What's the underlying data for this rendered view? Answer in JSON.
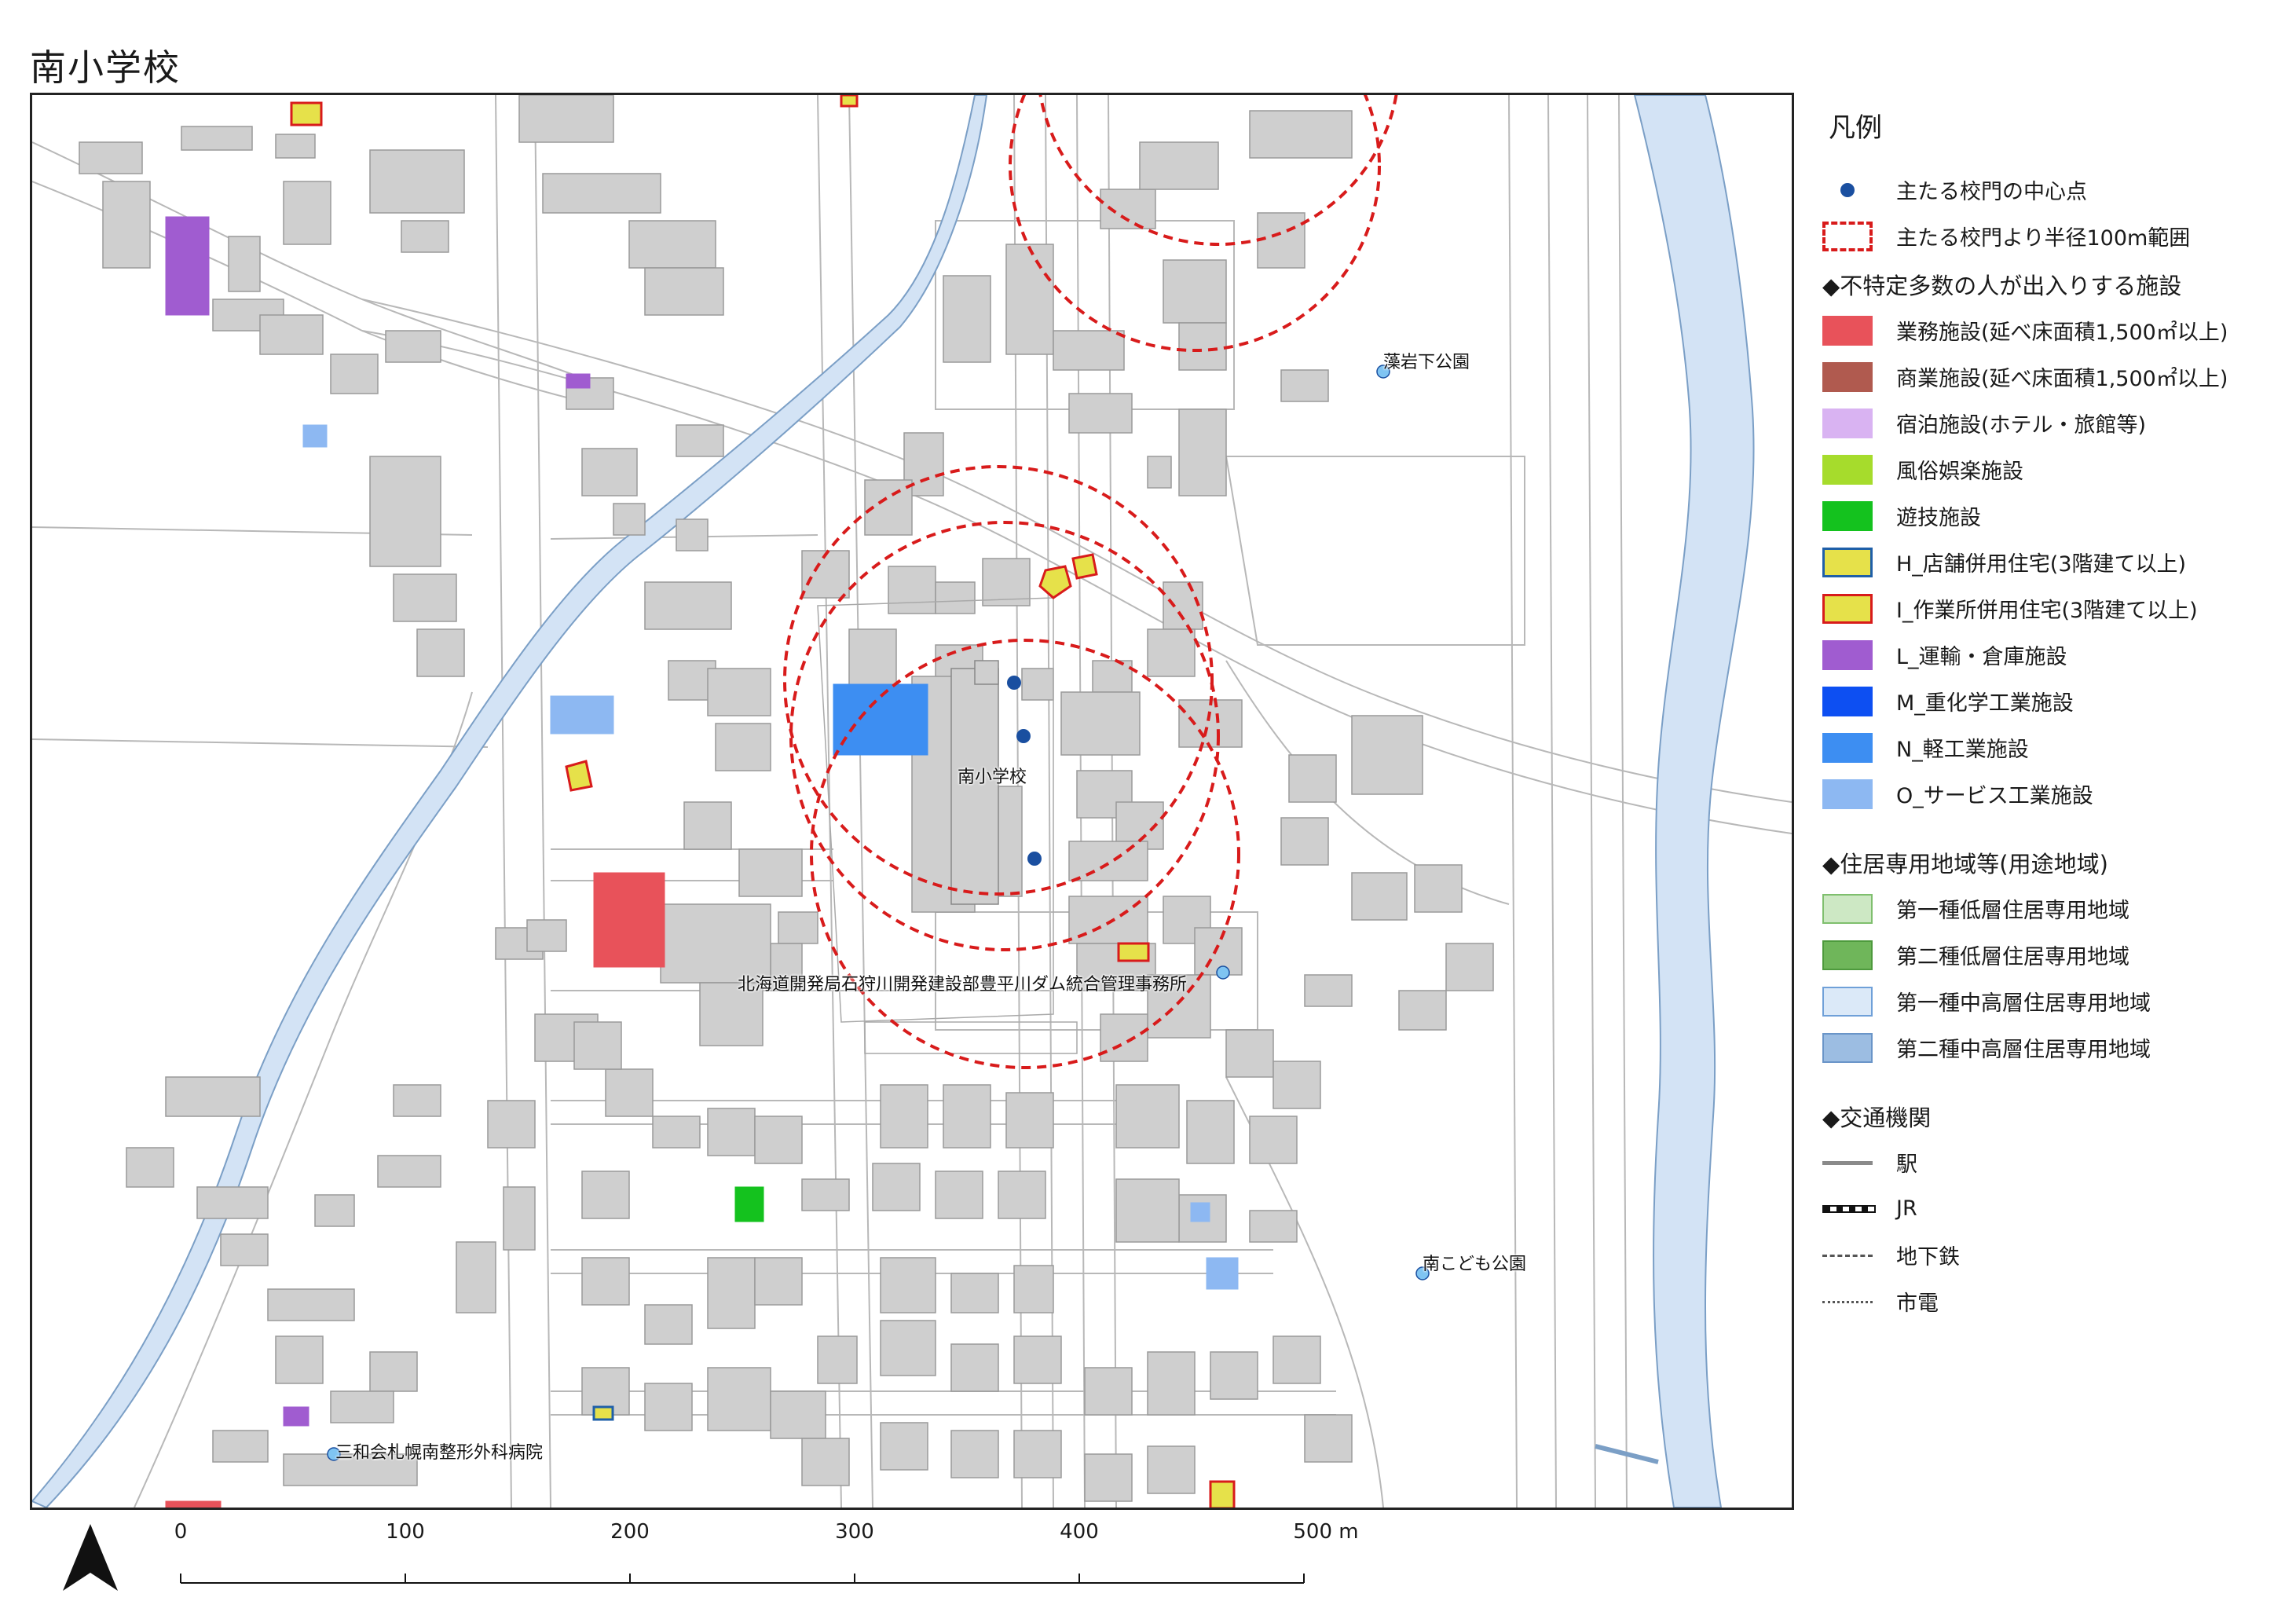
{
  "title": "南小学校",
  "map": {
    "school_label": "南小学校",
    "poi_labels": {
      "park1": "藻岩下公園",
      "park2": "南こども公園",
      "office": "北海道開発局石狩川開発建設部豊平川ダム統合管理事務所",
      "hospital": "三和会札幌南整形外科病院"
    }
  },
  "legend": {
    "title": "凡例",
    "gate_point": "主たる校門の中心点",
    "gate_radius": "主たる校門より半径100m範囲",
    "section_facilities": "◆不特定多数の人が出入りする施設",
    "facilities": [
      {
        "label": "業務施設(延べ床面積1,500㎡以上)",
        "fill": "#e8525a",
        "stroke": "#e8525a"
      },
      {
        "label": "商業施設(延べ床面積1,500㎡以上)",
        "fill": "#b05a4f",
        "stroke": "#b05a4f"
      },
      {
        "label": "宿泊施設(ホテル・旅館等)",
        "fill": "#d9b3f2",
        "stroke": "#d9b3f2"
      },
      {
        "label": "風俗娯楽施設",
        "fill": "#a6dc2c",
        "stroke": "#a6dc2c"
      },
      {
        "label": "遊技施設",
        "fill": "#14c21e",
        "stroke": "#14c21e"
      },
      {
        "label": "H_店舗併用住宅(3階建て以上)",
        "fill": "#e6e14a",
        "stroke": "#1f5fa8"
      },
      {
        "label": "I_作業所併用住宅(3階建て以上)",
        "fill": "#e6e14a",
        "stroke": "#d81b1b"
      },
      {
        "label": "L_運輸・倉庫施設",
        "fill": "#a05cd0",
        "stroke": "#a05cd0"
      },
      {
        "label": "M_重化学工業施設",
        "fill": "#0d4ff2",
        "stroke": "#0d4ff2"
      },
      {
        "label": "N_軽工業施設",
        "fill": "#3d8ef2",
        "stroke": "#3d8ef2"
      },
      {
        "label": "O_サービス工業施設",
        "fill": "#8db8f2",
        "stroke": "#8db8f2"
      }
    ],
    "section_zones": "◆住居専用地域等(用途地域)",
    "zones": [
      {
        "label": "第一種低層住居専用地域",
        "fill": "#cde8c4",
        "stroke": "#7fbf6e"
      },
      {
        "label": "第二種低層住居専用地域",
        "fill": "#6fb65a",
        "stroke": "#4e9a3d"
      },
      {
        "label": "第一種中高層住居専用地域",
        "fill": "#dbe9f8",
        "stroke": "#6fa0d8"
      },
      {
        "label": "第二種中高層住居専用地域",
        "fill": "#9cbde2",
        "stroke": "#6a95c8"
      }
    ],
    "section_transport": "◆交通機関",
    "transport": [
      {
        "label": "駅",
        "style": "solid-gray"
      },
      {
        "label": "JR",
        "style": "rail"
      },
      {
        "label": "地下鉄",
        "style": "dashed"
      },
      {
        "label": "市電",
        "style": "dotted"
      }
    ]
  },
  "scalebar": {
    "ticks": [
      "0",
      "100",
      "200",
      "300",
      "400",
      "500 m"
    ]
  },
  "colors": {
    "building": "#cfcfcf",
    "building_edge": "#9a9a9a",
    "road_edge": "#b8b8b8",
    "river": "#d3e3f5",
    "river_edge": "#7b9fc6",
    "circle": "#d81b1b",
    "gate": "#1a4fa0"
  }
}
